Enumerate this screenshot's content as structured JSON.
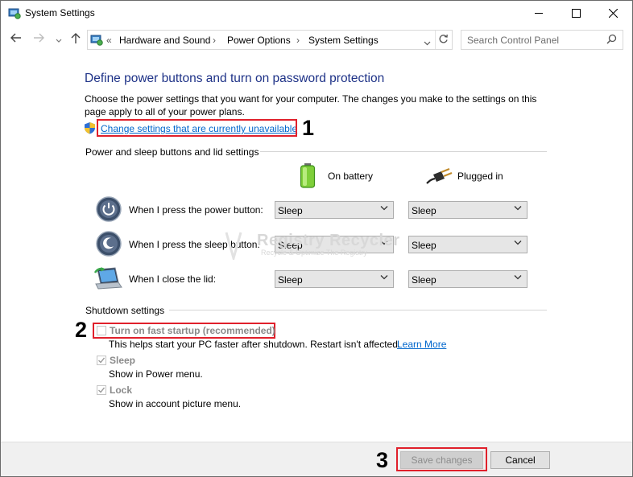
{
  "window": {
    "title": "System Settings"
  },
  "nav": {
    "breadcrumb": [
      "Hardware and Sound",
      "Power Options",
      "System Settings"
    ],
    "breadcrumb_prefix": "«",
    "search_placeholder": "Search Control Panel"
  },
  "main": {
    "heading": "Define power buttons and turn on password protection",
    "description": "Choose the power settings that you want for your computer. The changes you make to the settings on this page apply to all of your power plans.",
    "change_settings_link": "Change settings that are currently unavailable",
    "power_section_label": "Power and sleep buttons and lid settings",
    "col_battery": "On battery",
    "col_plugged": "Plugged in",
    "rows": [
      {
        "label": "When I press the power button:",
        "battery": "Sleep",
        "plugged": "Sleep"
      },
      {
        "label": "When I press the sleep button:",
        "battery": "Sleep",
        "plugged": "Sleep"
      },
      {
        "label": "When I close the lid:",
        "battery": "Sleep",
        "plugged": "Sleep"
      }
    ],
    "shutdown_section_label": "Shutdown settings",
    "fast_startup_label": "Turn on fast startup (recommended)",
    "fast_startup_checked": false,
    "fast_startup_desc": "This helps start your PC faster after shutdown. Restart isn't affected.",
    "learn_more": "Learn More",
    "sleep_label": "Sleep",
    "sleep_checked": true,
    "sleep_desc": "Show in Power menu.",
    "lock_label": "Lock",
    "lock_checked": true,
    "lock_desc": "Show in account picture menu."
  },
  "watermark": {
    "title": "Registry Recycler",
    "subtitle": "Recycle & Optimize The Registry"
  },
  "annotations": {
    "n1": "1",
    "n2": "2",
    "n3": "3"
  },
  "footer": {
    "save_label": "Save changes",
    "cancel_label": "Cancel"
  },
  "colors": {
    "accent": "#1e3287",
    "link": "#0066cc",
    "highlight": "#e0202b"
  }
}
